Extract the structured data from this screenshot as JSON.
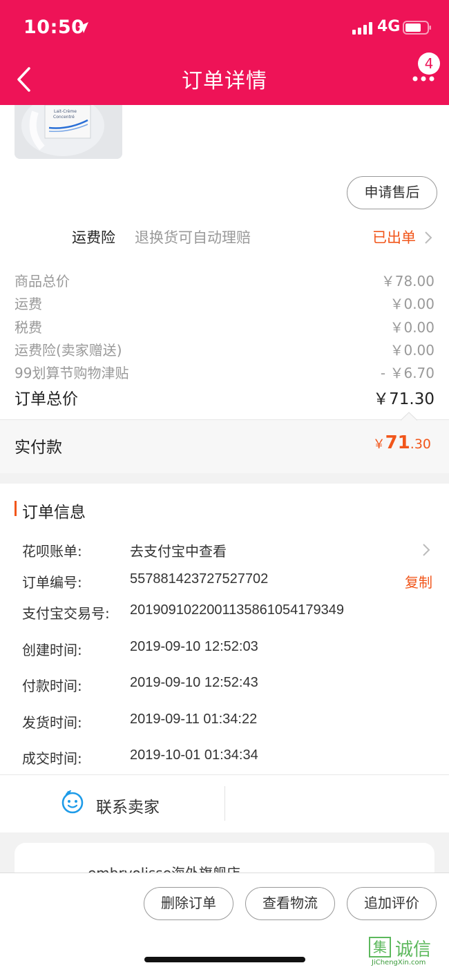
{
  "status_bar": {
    "time": "10:50",
    "network": "4G"
  },
  "nav": {
    "title": "订单详情",
    "badge_count": "4"
  },
  "product": {
    "image_alt_text_1": "Lait-Crème",
    "image_alt_text_2": "Concentré"
  },
  "after_sales_button": "申请售后",
  "insurance": {
    "title": "运费险",
    "desc": "退换货可自动理赔",
    "status": "已出单"
  },
  "fees": [
    {
      "label": "商品总价",
      "value": "￥78.00"
    },
    {
      "label": "运费",
      "value": "￥0.00"
    },
    {
      "label": "税费",
      "value": "￥0.00"
    },
    {
      "label": "运费险(卖家赠送)",
      "value": "￥0.00"
    },
    {
      "label": "99划算节购物津贴",
      "value": "- ￥6.70"
    }
  ],
  "total": {
    "label": "订单总价",
    "value": "￥71.30"
  },
  "paid": {
    "label": "实付款",
    "currency": "￥",
    "integer": "71",
    "decimal": ".30"
  },
  "order_info": {
    "title": "订单信息",
    "rows": [
      {
        "key": "花呗账单:",
        "value": "去支付宝中查看"
      },
      {
        "key": "订单编号:",
        "value": "557881423727527702",
        "action": "复制"
      },
      {
        "key": "支付宝交易号:",
        "value": "2019091022001135861054179349"
      },
      {
        "key": "创建时间:",
        "value": "2019-09-10 12:52:03"
      },
      {
        "key": "付款时间:",
        "value": "2019-09-10 12:52:43"
      },
      {
        "key": "发货时间:",
        "value": "2019-09-11 01:34:22"
      },
      {
        "key": "成交时间:",
        "value": "2019-10-01 01:34:34"
      }
    ]
  },
  "contact": {
    "label": "联系卖家"
  },
  "shop": {
    "name": "embryolisse海外旗舰店"
  },
  "bottom_actions": [
    "删除订单",
    "查看物流",
    "追加评价"
  ],
  "watermark": {
    "box_char": "集",
    "cn": "诚信",
    "en": "JiChengXin.com"
  },
  "colors": {
    "brand": "#ee1357",
    "accent": "#f1561b"
  }
}
